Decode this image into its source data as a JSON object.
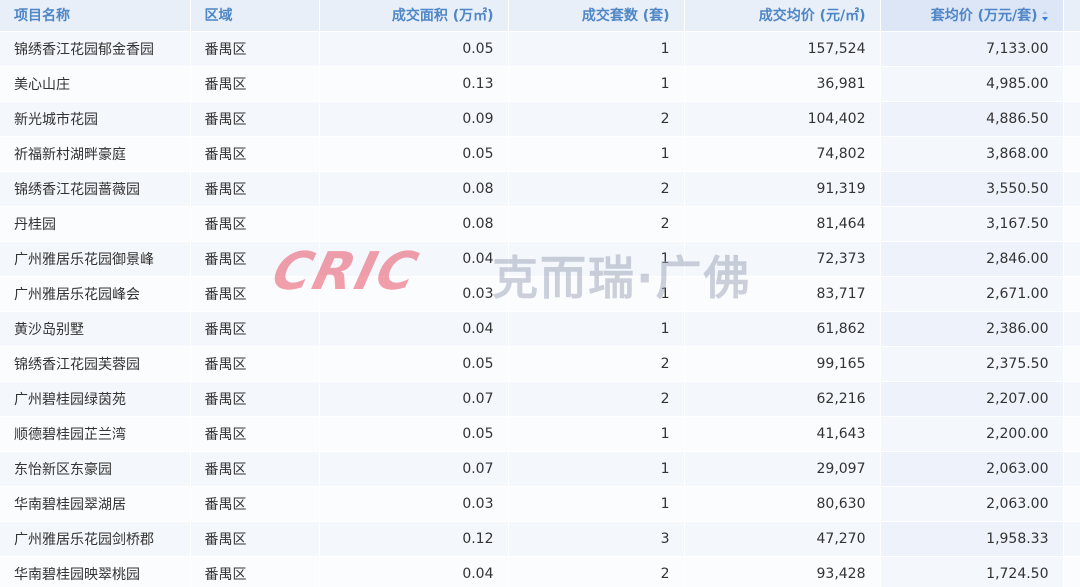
{
  "table": {
    "columns": [
      {
        "label": "项目名称",
        "align": "left"
      },
      {
        "label": "区域",
        "align": "left"
      },
      {
        "label": "成交面积 (万㎡)",
        "align": "right"
      },
      {
        "label": "成交套数 (套)",
        "align": "right"
      },
      {
        "label": "成交均价 (元/㎡)",
        "align": "right"
      },
      {
        "label": "套均价 (万元/套)",
        "align": "right",
        "sorted": "desc"
      }
    ],
    "rows": [
      [
        "锦绣香江花园郁金香园",
        "番禺区",
        "0.05",
        "1",
        "157,524",
        "7,133.00"
      ],
      [
        "美心山庄",
        "番禺区",
        "0.13",
        "1",
        "36,981",
        "4,985.00"
      ],
      [
        "新光城市花园",
        "番禺区",
        "0.09",
        "2",
        "104,402",
        "4,886.50"
      ],
      [
        "祈福新村湖畔豪庭",
        "番禺区",
        "0.05",
        "1",
        "74,802",
        "3,868.00"
      ],
      [
        "锦绣香江花园蔷薇园",
        "番禺区",
        "0.08",
        "2",
        "91,319",
        "3,550.50"
      ],
      [
        "丹桂园",
        "番禺区",
        "0.08",
        "2",
        "81,464",
        "3,167.50"
      ],
      [
        "广州雅居乐花园御景峰",
        "番禺区",
        "0.04",
        "1",
        "72,373",
        "2,846.00"
      ],
      [
        "广州雅居乐花园峰会",
        "番禺区",
        "0.03",
        "1",
        "83,717",
        "2,671.00"
      ],
      [
        "黄沙岛别墅",
        "番禺区",
        "0.04",
        "1",
        "61,862",
        "2,386.00"
      ],
      [
        "锦绣香江花园芙蓉园",
        "番禺区",
        "0.05",
        "2",
        "99,165",
        "2,375.50"
      ],
      [
        "广州碧桂园绿茵苑",
        "番禺区",
        "0.07",
        "2",
        "62,216",
        "2,207.00"
      ],
      [
        "顺德碧桂园芷兰湾",
        "番禺区",
        "0.05",
        "1",
        "41,643",
        "2,200.00"
      ],
      [
        "东怡新区东豪园",
        "番禺区",
        "0.07",
        "1",
        "29,097",
        "2,063.00"
      ],
      [
        "华南碧桂园翠湖居",
        "番禺区",
        "0.03",
        "1",
        "80,630",
        "2,063.00"
      ],
      [
        "广州雅居乐花园剑桥郡",
        "番禺区",
        "0.12",
        "3",
        "47,270",
        "1,958.33"
      ],
      [
        "华南碧桂园映翠桃园",
        "番禺区",
        "0.04",
        "2",
        "93,428",
        "1,724.50"
      ]
    ]
  },
  "watermark": {
    "logo": "CRIC",
    "text": "克而瑞·广佛"
  },
  "colors": {
    "header_text": "#4f86c6",
    "header_bg": "#e8eff9",
    "row_bg": "#f4f7fc",
    "sort_indicator": "#2f7de1",
    "watermark_logo": "#e8435a"
  },
  "icons": {
    "sort": "sort-desc-icon"
  }
}
